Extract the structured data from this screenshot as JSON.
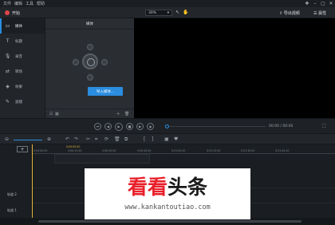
{
  "menubar": {
    "items": [
      "文件",
      "编辑",
      "工具",
      "帮助"
    ]
  },
  "toolbar": {
    "app_name": "开始",
    "zoom_value": "30%",
    "export_label": "导出视频",
    "properties_label": "属性"
  },
  "sidebar": {
    "items": [
      {
        "label": "媒体",
        "icon": "media-icon",
        "glyph": "▭"
      },
      {
        "label": "标题",
        "icon": "title-icon",
        "glyph": "T"
      },
      {
        "label": "录音",
        "icon": "microphone-icon",
        "glyph": "🎙"
      },
      {
        "label": "转场",
        "icon": "transition-icon",
        "glyph": "⇄"
      },
      {
        "label": "效果",
        "icon": "effects-icon",
        "glyph": "◈"
      },
      {
        "label": "滤镜",
        "icon": "filter-icon",
        "glyph": "✎"
      }
    ]
  },
  "media_panel": {
    "tab_label": "媒体",
    "import_label": "导入媒体..."
  },
  "playback": {
    "time": "00:00 / 00:00"
  },
  "timeline": {
    "playhead_time": "0:00:00.00",
    "ruler_ticks": [
      "0:00:00.00",
      "0:00:15.00",
      "0:00:30.00",
      "0:00:45.00",
      "0:01:00.00",
      "0:01:15.00",
      "0:01:30.00",
      "0:01:45.00"
    ],
    "tracks": [
      "轨道 2",
      "轨道 1"
    ]
  },
  "watermark": {
    "brand_accent": "看看",
    "brand_rest": "头条",
    "url": "www.kankantoutiao.com"
  },
  "colors": {
    "accent": "#2a8de0",
    "brand_red": "#e8202a",
    "playhead": "#e3b339"
  }
}
